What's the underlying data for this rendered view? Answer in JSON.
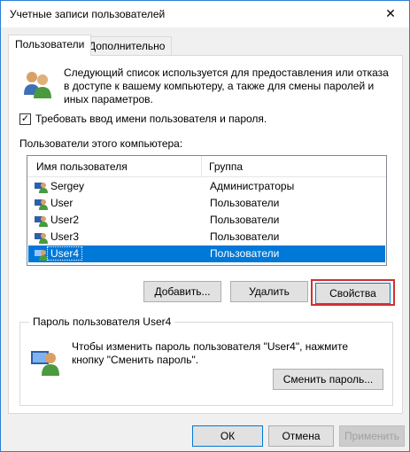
{
  "window": {
    "title": "Учетные записи пользователей",
    "close_glyph": "✕"
  },
  "tabs": [
    {
      "label": "Пользователи",
      "active": true
    },
    {
      "label": "Дополнительно",
      "active": false
    }
  ],
  "info_text": "Следующий список используется для предоставления или отказа в доступе к вашему компьютеру, а также для смены паролей и иных параметров.",
  "checkbox": {
    "label": "Требовать ввод имени пользователя и пароля.",
    "checked": true,
    "mark": "✓"
  },
  "users_list": {
    "label": "Пользователи этого компьютера:",
    "columns": [
      "Имя пользователя",
      "Группа"
    ],
    "rows": [
      {
        "name": "Sergey",
        "group": "Администраторы"
      },
      {
        "name": "User",
        "group": "Пользователи"
      },
      {
        "name": "User2",
        "group": "Пользователи"
      },
      {
        "name": "User3",
        "group": "Пользователи"
      },
      {
        "name": "User4",
        "group": "Пользователи"
      }
    ],
    "selected_index": 4
  },
  "buttons": {
    "add": "Добавить...",
    "remove": "Удалить",
    "properties": "Свойства",
    "change_password": "Сменить пароль...",
    "ok": "ОК",
    "cancel": "Отмена",
    "apply": "Применить"
  },
  "password_group": {
    "title": "Пароль пользователя User4",
    "text": "Чтобы изменить пароль пользователя \"User4\", нажмите кнопку \"Сменить пароль\"."
  },
  "icons": {
    "users": "users-icon",
    "user_row": "user-icon",
    "password": "user-password-icon"
  },
  "colors": {
    "selection": "#0078d7",
    "highlight_box": "#d32f2f",
    "window_border": "#2b7fd4"
  }
}
